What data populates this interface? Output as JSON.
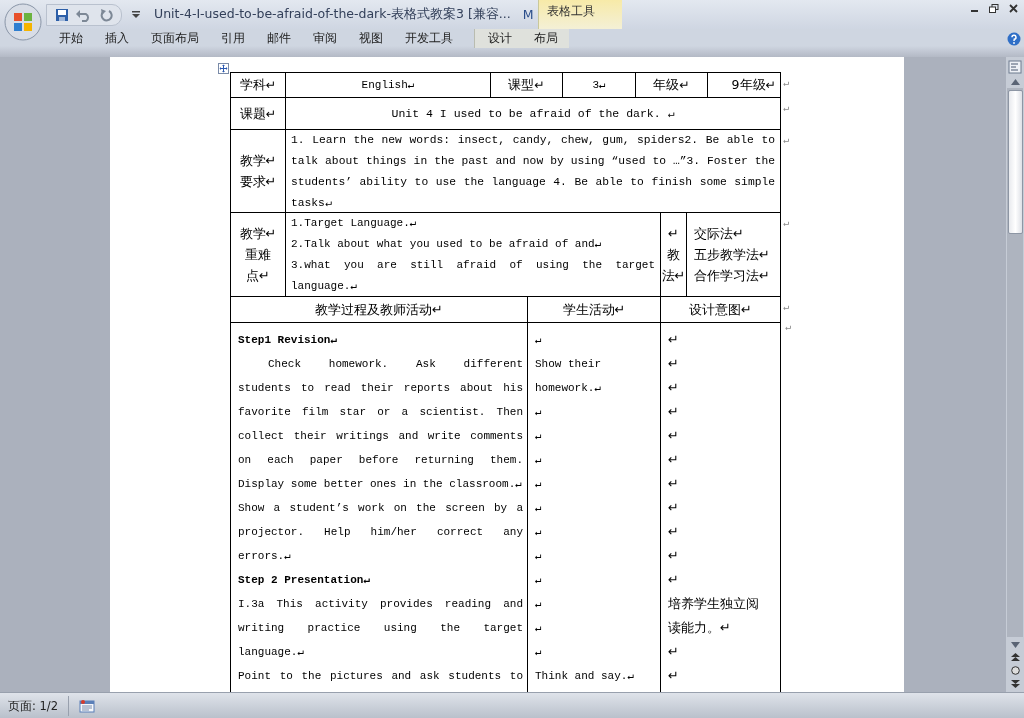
{
  "window": {
    "title": "Unit-4-I-used-to-be-afraid-of-the-dark-表格式教案3 [兼容...",
    "title_tail": "M",
    "context_group": "表格工具"
  },
  "ribbon_tabs": [
    {
      "label": "开始",
      "selected": false
    },
    {
      "label": "插入",
      "selected": false
    },
    {
      "label": "页面布局",
      "selected": false
    },
    {
      "label": "引用",
      "selected": false
    },
    {
      "label": "邮件",
      "selected": false
    },
    {
      "label": "审阅",
      "selected": false
    },
    {
      "label": "视图",
      "selected": false
    },
    {
      "label": "开发工具",
      "selected": false
    },
    {
      "label": "设计",
      "selected": false,
      "kind": "context"
    },
    {
      "label": "布局",
      "selected": false,
      "kind": "context"
    }
  ],
  "table": {
    "info_row": {
      "cells": [
        "学科↵",
        "English↵",
        "课型↵",
        "3↵",
        "年级↵",
        "9年级↵"
      ],
      "row_end": "↵"
    },
    "topic_row": {
      "label": "课题↵",
      "value": "Unit 4  I used to be afraid of the dark. ↵",
      "row_end": "↵"
    },
    "requirements_row": {
      "label": [
        "教学↵",
        "要求↵"
      ],
      "value": "1. Learn the new words: insect, candy, chew, gum, spiders2. Be able to talk about things in the past and now by using “used to …”3. Foster the students’ ability to use the language   4. Be able to finish some simple tasks↵",
      "row_end": "↵"
    },
    "focus_row": {
      "label": [
        "教学↵",
        "重难",
        "点↵"
      ],
      "lines": [
        "1.Target Language.↵",
        "2.Talk about what you used to be afraid of and↵",
        "3.what you are still afraid of using the target",
        "language.↵"
      ],
      "method_label": [
        "↵",
        "教",
        "法↵"
      ],
      "methods": [
        "交际法↵",
        "五步教学法↵",
        "合作学习法↵"
      ],
      "row_end": "↵"
    },
    "process_header": {
      "columns": [
        "教学过程及教师活动↵",
        "学生活动↵",
        "设计意图↵"
      ],
      "row_end": "↵"
    },
    "process_lines": [
      {
        "kind": "heading",
        "activity": "Step1 Revision↵",
        "student": "↵",
        "purpose": "↵",
        "row_end": "↵"
      },
      {
        "kind": "first",
        "activity": "Check homework. Ask different",
        "student": "Show their",
        "purpose": "↵"
      },
      {
        "kind": "line",
        "activity": "students to read their reports about his",
        "student": "homework.↵",
        "purpose": "↵"
      },
      {
        "kind": "line",
        "activity": "favorite film star or a scientist. Then",
        "student": "↵",
        "purpose": "↵"
      },
      {
        "kind": "line",
        "activity": "collect their writings and write comments",
        "student": "↵",
        "purpose": "↵"
      },
      {
        "kind": "line",
        "activity": "on each paper before returning them.",
        "student": "↵",
        "purpose": "↵"
      },
      {
        "kind": "end",
        "activity": "Display some better ones in the classroom.↵",
        "student": "↵",
        "purpose": "↵"
      },
      {
        "kind": "line",
        "activity": "Show a student’s work on the screen by a",
        "student": "↵",
        "purpose": "↵"
      },
      {
        "kind": "line",
        "activity": "projector. Help him/her correct any",
        "student": "↵",
        "purpose": "↵"
      },
      {
        "kind": "end",
        "activity": "errors.↵",
        "student": "↵",
        "purpose": "↵"
      },
      {
        "kind": "heading",
        "activity": "Step 2  Presentation↵",
        "student": "↵",
        "purpose": "↵"
      },
      {
        "kind": "line",
        "activity": "I.3a This activity provides reading and",
        "student": "↵",
        "purpose": "培养学生独立阅"
      },
      {
        "kind": "line",
        "activity": "writing practice using the target",
        "student": "↵",
        "purpose": "读能力。↵"
      },
      {
        "kind": "end",
        "activity": "language.↵",
        "student": "↵",
        "purpose": "↵"
      },
      {
        "kind": "line",
        "activity": "Point to the pictures and ask students to",
        "student": "Think and say.↵",
        "purpose": "↵"
      }
    ]
  },
  "status_bar": {
    "page": "页面: 1/2"
  }
}
